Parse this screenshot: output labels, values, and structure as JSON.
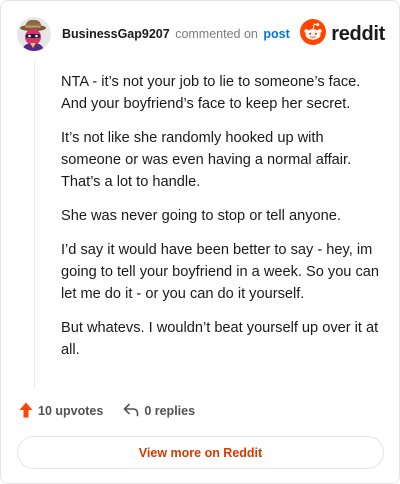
{
  "header": {
    "username": "BusinessGap9207",
    "commented_text": "commented on",
    "post_link": "post",
    "brand": "reddit",
    "brand_color": "#ff4500"
  },
  "comment": {
    "paragraphs": [
      "NTA - it’s not your job to lie to someone’s face. And your boyfriend’s face to keep her secret.",
      "It’s not like she randomly hooked up with someone or was even having a normal affair. That’s a lot to handle.",
      "She was never going to stop or tell anyone.",
      "I’d say it would have been better to say - hey, im going to tell your boyfriend in a week. So you can let me do it - or you can do it yourself.",
      "But whatevs. I wouldn’t beat yourself up over it at all."
    ]
  },
  "actions": {
    "upvotes": "10 upvotes",
    "replies": "0 replies",
    "upvote_icon": "arrow-up-icon",
    "reply_icon": "reply-icon"
  },
  "footer": {
    "view_button": "View more on Reddit",
    "accent": "#d93a00"
  }
}
